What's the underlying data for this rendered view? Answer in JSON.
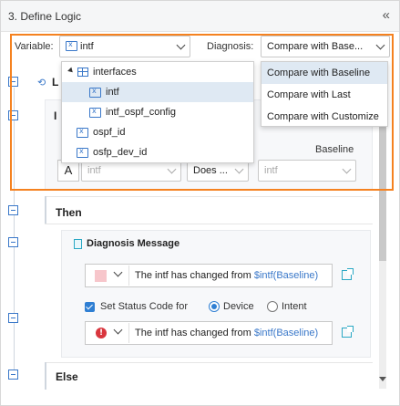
{
  "panel": {
    "title": "3. Define Logic",
    "collapse_glyph": "«"
  },
  "variable": {
    "label": "Variable:",
    "selected": "intf",
    "tree": [
      {
        "label": "interfaces",
        "icon": "table-icon",
        "expanded": true
      },
      {
        "label": "intf",
        "icon": "variable-icon",
        "selected": true
      },
      {
        "label": "intf_ospf_config",
        "icon": "variable-icon"
      },
      {
        "label": "ospf_id",
        "icon": "variable-icon"
      },
      {
        "label": "osfp_dev_id",
        "icon": "variable-icon"
      }
    ]
  },
  "diagnosis": {
    "label": "Diagnosis:",
    "selected": "Compare with Base...",
    "options": [
      "Compare with Baseline",
      "Compare with Last",
      "Compare with Customize"
    ]
  },
  "loop_partial": "L",
  "if_partial": "I",
  "baseline_label": "Baseline",
  "condition": {
    "a_label": "A",
    "left_value": "intf",
    "operator": "Does ...",
    "right_value": "intf"
  },
  "then_label": "Then",
  "diagnosis_message": {
    "title": "Diagnosis Message",
    "message_1": {
      "prefix": "The intf has changed from ",
      "var": "$intf(Baseline)"
    },
    "status_label": "Set Status Code for",
    "radio_device": "Device",
    "radio_intent": "Intent",
    "message_2": {
      "prefix": "The intf has changed from ",
      "var": "$intf(Baseline)"
    },
    "error_glyph": "!"
  },
  "else_label": "Else",
  "colors": {
    "accent_orange": "#f58220",
    "link_blue": "#3a78c9",
    "error_red": "#d9363e"
  }
}
